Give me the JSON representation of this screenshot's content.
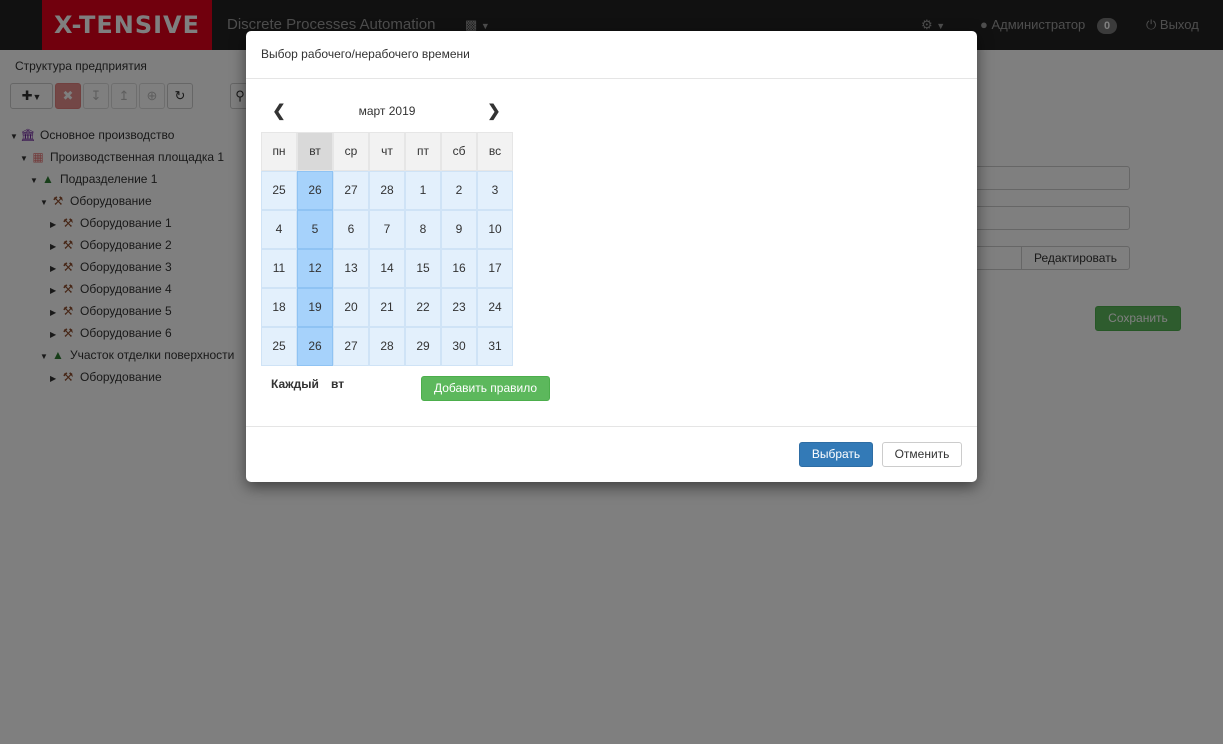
{
  "navbar": {
    "brand": "X-TENSIVE",
    "title": "Discrete Processes Automation",
    "cubes_icon": "cubes-icon",
    "settings_icon": "gear-icon",
    "user_label": "Администратор",
    "notification_count": "0",
    "logout_label": "Выход",
    "brand_color": "#e2001a"
  },
  "sidebar": {
    "title": "Структура предприятия",
    "tree": [
      {
        "label": "Основное производство",
        "icon": "bank-icon"
      },
      {
        "label": "Производственная площадка 1",
        "icon": "building-icon"
      },
      {
        "label": "Подразделение 1",
        "icon": "sitemap-icon"
      },
      {
        "label": "Оборудование",
        "icon": "hammer-icon"
      },
      {
        "label": "Оборудование 1",
        "icon": "hammer-icon"
      },
      {
        "label": "Оборудование 2",
        "icon": "hammer-icon"
      },
      {
        "label": "Оборудование 3",
        "icon": "hammer-icon"
      },
      {
        "label": "Оборудование 4",
        "icon": "hammer-icon"
      },
      {
        "label": "Оборудование 5",
        "icon": "hammer-icon"
      },
      {
        "label": "Оборудование 6",
        "icon": "hammer-icon"
      },
      {
        "label": "Участок отделки поверхности",
        "icon": "sitemap-icon"
      },
      {
        "label": "Оборудование",
        "icon": "hammer-icon"
      }
    ]
  },
  "form": {
    "edit_label": "Редактировать",
    "save_label": "Сохранить"
  },
  "modal": {
    "title": "Выбор рабочего/нерабочего времени",
    "month_label": "март 2019",
    "weekdays": [
      "пн",
      "вт",
      "ср",
      "чт",
      "пт",
      "сб",
      "вс"
    ],
    "selected_weekday_index": 1,
    "weeks": [
      [
        "25",
        "26",
        "27",
        "28",
        "1",
        "2",
        "3"
      ],
      [
        "4",
        "5",
        "6",
        "7",
        "8",
        "9",
        "10"
      ],
      [
        "11",
        "12",
        "13",
        "14",
        "15",
        "16",
        "17"
      ],
      [
        "18",
        "19",
        "20",
        "21",
        "22",
        "23",
        "24"
      ],
      [
        "25",
        "26",
        "27",
        "28",
        "29",
        "30",
        "31"
      ]
    ],
    "rule_every_label": "Каждый",
    "rule_day_label": "вт",
    "add_rule_label": "Добавить правило",
    "choose_label": "Выбрать",
    "cancel_label": "Отменить",
    "day_color": "#e3f0fc",
    "selected_day_color": "#a6d2fb"
  }
}
